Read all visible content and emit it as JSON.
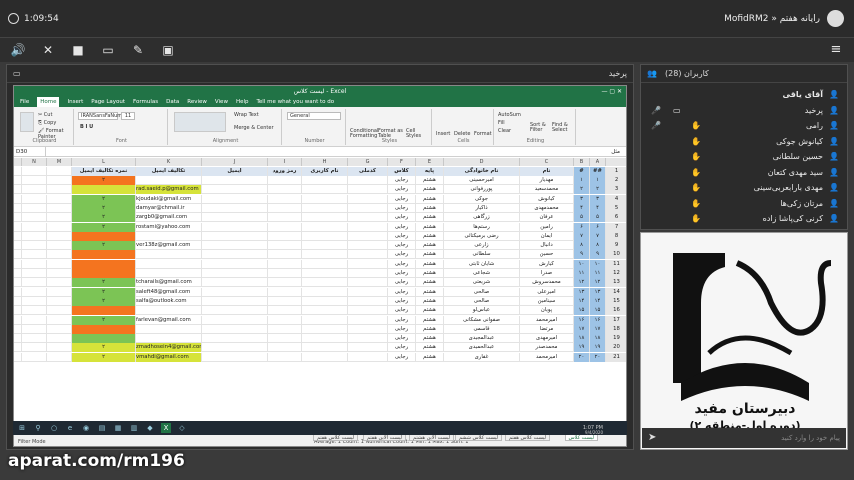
{
  "top": {
    "time": "1:09:54",
    "title": "MofidRM2 » رایانه هفتم"
  },
  "toolbar": {
    "icons": [
      "speaker-icon",
      "mic-off-icon",
      "camera-icon",
      "screen-icon",
      "pen-icon",
      "share-icon"
    ],
    "menu": "≡"
  },
  "share_panel": {
    "title": "پرخید"
  },
  "users_panel": {
    "title": "کاربران (28)",
    "users": [
      "آقای یاقی",
      "پرخید",
      "رامی",
      "کیانوش جوکی",
      "حسین سلطانی",
      "سید مهدی کتعان",
      "مهدی بارابعربی‌سینی",
      "مرتان زکی‌ها",
      "کرنی کی‌پاشا زاده"
    ]
  },
  "logo": {
    "line1": "مجتمع آموزشی مفید",
    "line2": "دبیرستان مفید",
    "line3": "(دوره اول-منطقه ۲)"
  },
  "chat": {
    "placeholder": "پیام خود را وارد کنید"
  },
  "watermark": "aparat.com/rm196",
  "excel": {
    "title": "لیست کلاس - Excel",
    "tabs": [
      "File",
      "Home",
      "Insert",
      "Page Layout",
      "Formulas",
      "Data",
      "Review",
      "View",
      "Help",
      "Tell me what you want to do"
    ],
    "font": "IRANSansFaNum",
    "size": "11",
    "namebox": "D30",
    "formula": "مثل",
    "groups": [
      "Clipboard",
      "Font",
      "Alignment",
      "Number",
      "Styles",
      "Cells",
      "Editing"
    ],
    "buttons": {
      "wrap": "Wrap Text",
      "merge": "Merge & Center",
      "general": "General",
      "cond": "Conditional Formatting",
      "fmt": "Format as Table",
      "cell": "Cell Styles",
      "insert": "Insert",
      "delete": "Delete",
      "format": "Format",
      "autosum": "AutoSum",
      "fill": "Fill",
      "clear": "Clear",
      "sort": "Sort & Filter",
      "find": "Find & Select"
    },
    "col_letters": [
      "A",
      "B",
      "C",
      "D",
      "E",
      "F",
      "G",
      "H",
      "I",
      "J",
      "K",
      "L",
      "M",
      "N",
      "O",
      "P"
    ],
    "headers": [
      "##",
      "#",
      "نام",
      "نام خانوادگی",
      "پایه",
      "کلاس",
      "کدملی",
      "نام کاربری",
      "رمز ورود",
      "ایمیل",
      "تکالیف ایمیل",
      "نمره تکالیف ایمیل"
    ],
    "rows": [
      [
        "۱",
        "۱",
        "مهدیار",
        "امیرحسینی",
        "هشتم",
        "رجایی",
        "",
        "",
        "",
        "",
        "",
        "۲"
      ],
      [
        "۲",
        "۲",
        "محمدسعید",
        "پوررفوانی",
        "هشتم",
        "رجایی",
        "",
        "",
        "",
        "",
        "rad.saeid.p@gmail.com",
        ""
      ],
      [
        "۳",
        "۳",
        "کیانوش",
        "جوکی",
        "هشتم",
        "رجایی",
        "",
        "",
        "",
        "",
        "kjoudaki@gmail.com",
        "۲"
      ],
      [
        "۴",
        "۴",
        "محمدمهدی",
        "ذاکیار",
        "هشتم",
        "رجایی",
        "",
        "",
        "",
        "",
        "damyar@chmail.ir",
        "۲"
      ],
      [
        "۵",
        "۵",
        "عرفان",
        "زرگاهی",
        "هشتم",
        "رجایی",
        "",
        "",
        "",
        "",
        "zargb0@gmail.com",
        "۲"
      ],
      [
        "۶",
        "۶",
        "رامین",
        "رستم‌ها",
        "هشتم",
        "رجایی",
        "",
        "",
        "",
        "",
        "rostami@yahoo.com",
        "۲"
      ],
      [
        "۷",
        "۷",
        "ایمان",
        "رضی برمیکتائی",
        "هشتم",
        "رجایی",
        "",
        "",
        "",
        "",
        "",
        ""
      ],
      [
        "۸",
        "۸",
        "دانیال",
        "زارعی",
        "هشتم",
        "رجایی",
        "",
        "",
        "",
        "",
        "ver138z@gmail.com",
        "۲"
      ],
      [
        "۹",
        "۹",
        "حسین",
        "سلطانی",
        "هشتم",
        "رجایی",
        "",
        "",
        "",
        "",
        "",
        ""
      ],
      [
        "۱۰",
        "۱۰",
        "کیارش",
        "شایان ثابتی",
        "هشتم",
        "رجایی",
        "",
        "",
        "",
        "",
        "",
        ""
      ],
      [
        "۱۱",
        "۱۱",
        "صدرا",
        "شجاعی",
        "هشتم",
        "رجایی",
        "",
        "",
        "",
        "",
        "",
        ""
      ],
      [
        "۱۲",
        "۱۲",
        "محمدسروش",
        "شریعتی",
        "هشتم",
        "رجایی",
        "",
        "",
        "",
        "",
        "tcharails@gmail.com",
        "۲"
      ],
      [
        "۱۳",
        "۱۳",
        "امیرعلی",
        "صالحی",
        "هشتم",
        "رجایی",
        "",
        "",
        "",
        "",
        "saleft48@gmail.com",
        "۲"
      ],
      [
        "۱۴",
        "۱۴",
        "سینامین",
        "صالحی",
        "هشتم",
        "رجایی",
        "",
        "",
        "",
        "",
        "salfa@outlook.com",
        "۲"
      ],
      [
        "۱۵",
        "۱۵",
        "پویان",
        "عباس‌لو",
        "هشتم",
        "رجایی",
        "",
        "",
        "",
        "",
        "",
        ""
      ],
      [
        "۱۶",
        "۱۶",
        "امیرمحمد",
        "صفوانی مشکانی",
        "هشتم",
        "رجایی",
        "",
        "",
        "",
        "",
        "farlevan@gmail.com",
        "۲"
      ],
      [
        "۱۷",
        "۱۷",
        "مرتضا",
        "قاسمی",
        "هشتم",
        "رجایی",
        "",
        "",
        "",
        "",
        "",
        ""
      ],
      [
        "۱۸",
        "۱۸",
        "امیرمهدی",
        "عبدالمجیدی",
        "هشتم",
        "رجایی",
        "",
        "",
        "",
        "",
        "",
        ""
      ],
      [
        "۱۹",
        "۱۹",
        "محمدصدر",
        "عبدالحمیدی",
        "هشتم",
        "رجایی",
        "",
        "",
        "",
        "",
        "zmadhosein4@gmail.com",
        "۲"
      ],
      [
        "۲۰",
        "۲۰",
        "امیرمحمد",
        "غفاری",
        "هشتم",
        "رجایی",
        "",
        "",
        "",
        "",
        "vmahdi@gmail.com",
        "۲"
      ]
    ],
    "row_fill": [
      "orange",
      "yellow",
      "green",
      "green",
      "green",
      "green",
      "orange",
      "green",
      "orange",
      "orange",
      "orange",
      "green",
      "green",
      "green",
      "orange",
      "green",
      "orange",
      "green",
      "yellow",
      "yellow"
    ],
    "sheets": [
      "لیست کلاس",
      "لیست کلاس هفتم",
      "لیست کلاس ششم",
      "لیست آلاین هشتم",
      "لیست آلاین هفتم",
      "لیست کلاس هفتم"
    ],
    "status": "Average: 1  Count: 1  Numerical Count: 1  Min: 1  Max: 1  Sum: 1",
    "mode": "Filter Mode",
    "clock": "1:07 PM",
    "date": "9/4/2020"
  },
  "colors": {
    "orange": "#f4741f",
    "yellow": "#d6e33a",
    "green": "#7cc455",
    "excel": "#217346"
  }
}
